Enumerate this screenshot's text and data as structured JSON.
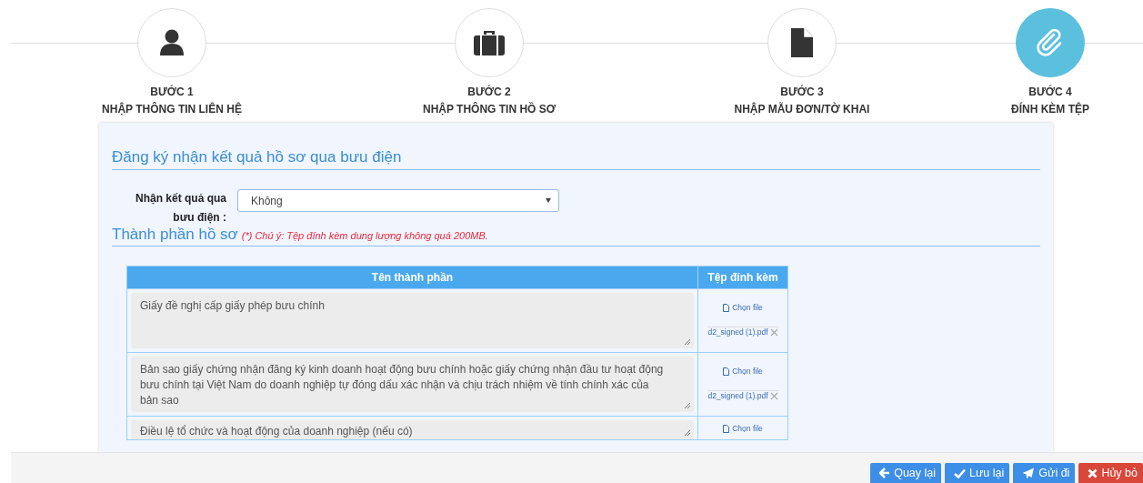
{
  "steps": [
    {
      "title": "BƯỚC 1",
      "label": "NHẬP THÔNG TIN LIÊN HỆ",
      "kind": "person",
      "selected": false
    },
    {
      "title": "BƯỚC 2",
      "label": "NHẬP THÔNG TIN HỒ SƠ",
      "kind": "briefcase",
      "selected": false
    },
    {
      "title": "BƯỚC 3",
      "label": "NHẬP MẪU ĐƠN/TỜ KHAI",
      "kind": "document",
      "selected": false
    },
    {
      "title": "BƯỚC 4",
      "label": "ĐÍNH KÈM TỆP",
      "kind": "paperclip",
      "selected": true
    }
  ],
  "postal_section": {
    "title": "Đăng ký nhận kết quả hồ sơ qua bưu điện",
    "field_label": "Nhận kết quả qua bưu điện :",
    "select_value": "Không"
  },
  "documents_section": {
    "title": "Thành phần hồ sơ",
    "note": "(*) Chú ý: Tệp đính kèm dung lượng không quá 200MB.",
    "table": {
      "columns": [
        "Tên thành phần",
        "Tệp đính kèm"
      ],
      "rows": [
        {
          "name": "Giấy đề nghị cấp giấy phép bưu chính",
          "choose_label": "Chọn file",
          "file": "d2_signed (1).pdf"
        },
        {
          "name": "Bản sao giấy chứng nhận đăng ký kinh doanh hoạt động bưu chính hoặc giấy chứng nhận đầu tư hoạt động bưu chính tại Việt Nam do doanh nghiệp tự đóng dấu xác nhận và chịu trách nhiệm về tính chính xác của bản sao",
          "choose_label": "Chọn file",
          "file": "d2_signed (1).pdf"
        },
        {
          "name": "Điều lệ tổ chức và hoạt động của doanh nghiệp (nếu có)",
          "choose_label": "Chọn file"
        }
      ]
    }
  },
  "buttons": [
    {
      "label": "Quay lại",
      "kind": "back"
    },
    {
      "label": "Lưu lại",
      "kind": "save"
    },
    {
      "label": "Gửi đi",
      "kind": "send"
    },
    {
      "label": "Hủy bỏ",
      "kind": "cancel"
    }
  ]
}
